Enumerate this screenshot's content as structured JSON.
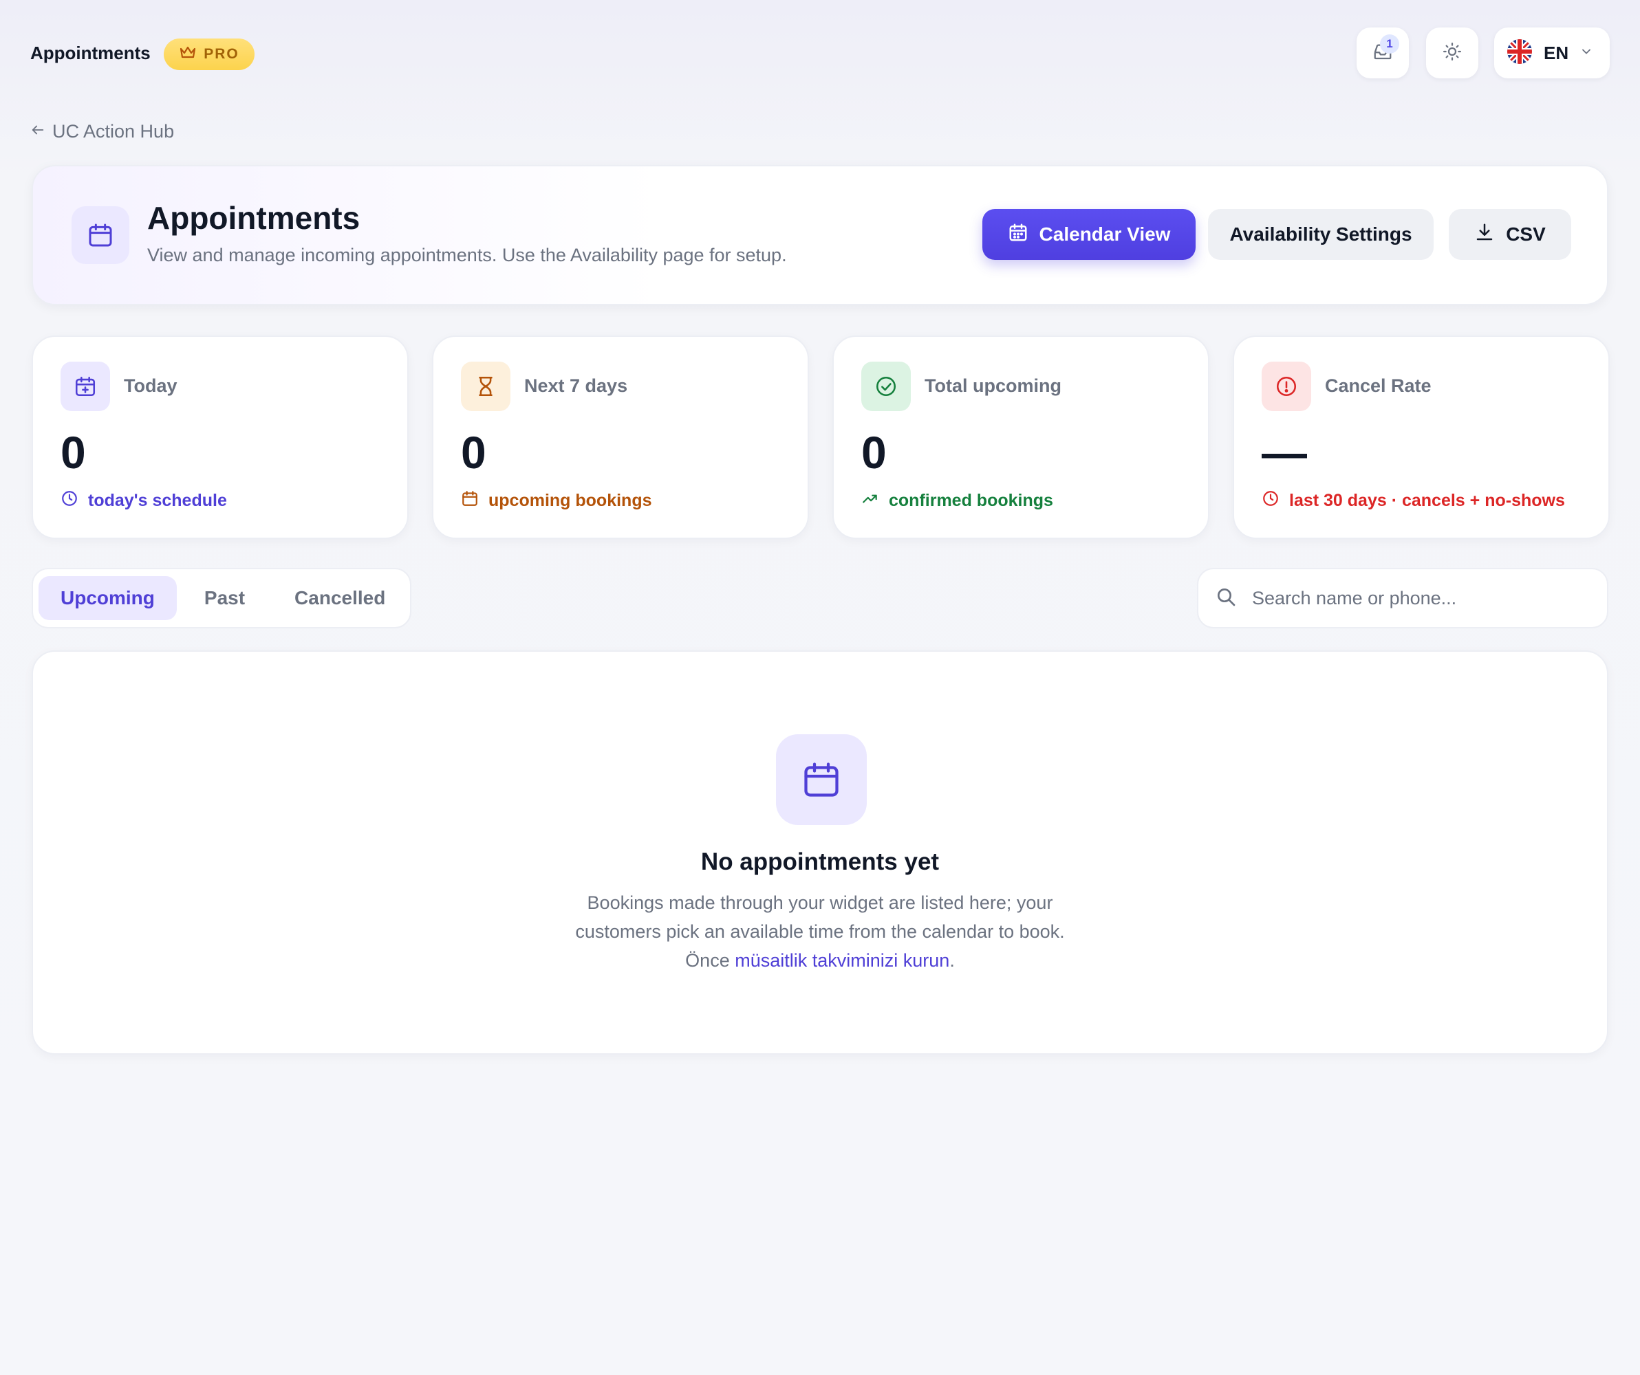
{
  "topbar": {
    "title": "Appointments",
    "pro_badge": "PRO",
    "notifications_count": "1",
    "language_code": "EN"
  },
  "back_link": {
    "label": "UC Action Hub"
  },
  "header": {
    "title": "Appointments",
    "subtitle": "View and manage incoming appointments. Use the Availability page for setup.",
    "buttons": {
      "calendar_view": "Calendar View",
      "availability_settings": "Availability Settings",
      "csv": "CSV"
    }
  },
  "stats": [
    {
      "label": "Today",
      "value": "0",
      "footer": "today's schedule",
      "accent": "#4f3fd6",
      "icon": "calendar-plus-icon"
    },
    {
      "label": "Next 7 days",
      "value": "0",
      "footer": "upcoming bookings",
      "accent": "#b45309",
      "icon": "hourglass-icon"
    },
    {
      "label": "Total upcoming",
      "value": "0",
      "footer": "confirmed bookings",
      "accent": "#15803d",
      "icon": "check-circle-icon"
    },
    {
      "label": "Cancel Rate",
      "value": "—",
      "footer": "last 30 days · cancels + no-shows",
      "accent": "#dc2626",
      "icon": "alert-circle-icon"
    }
  ],
  "tabs": [
    {
      "label": "Upcoming",
      "active": true
    },
    {
      "label": "Past",
      "active": false
    },
    {
      "label": "Cancelled",
      "active": false
    }
  ],
  "search": {
    "placeholder": "Search name or phone...",
    "value": ""
  },
  "empty_state": {
    "title": "No appointments yet",
    "line1": "Bookings made through your widget are listed here; your",
    "line2": "customers pick an available time from the calendar to book.",
    "line3_prefix": "Önce",
    "line3_link": "müsaitlik takviminizi kurun",
    "line3_suffix": "."
  },
  "colors": {
    "primary": "#4f46e5",
    "pro_badge_bg": "#fcd34d",
    "background": "#f5f6fa"
  }
}
